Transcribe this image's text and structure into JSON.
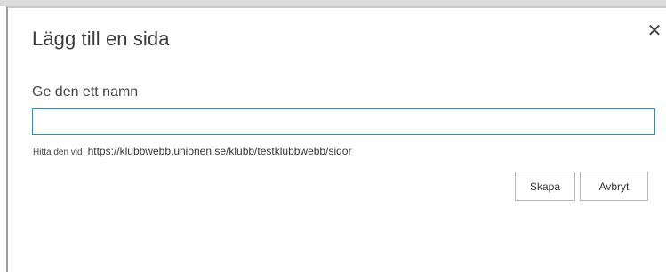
{
  "dialog": {
    "title": "Lägg till en sida",
    "close_glyph": "✕",
    "name_label": "Ge den ett namn",
    "name_value": "",
    "url_label": "Hitta den vid",
    "url_value": "https://klubbwebb.unionen.se/klubb/testklubbwebb/sidor",
    "create_label": "Skapa",
    "cancel_label": "Avbryt"
  }
}
